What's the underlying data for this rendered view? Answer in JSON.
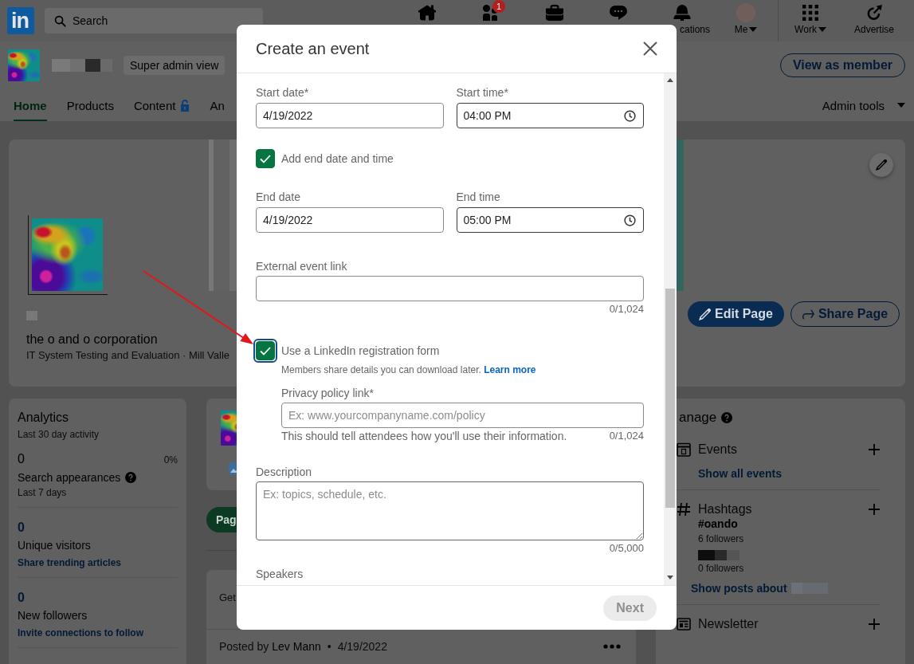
{
  "nav": {
    "logo": "in",
    "search": {
      "placeholder": "Search"
    },
    "items": [
      {
        "kind": "home",
        "dropdown": false
      },
      {
        "kind": "network",
        "badge": "1",
        "dropdown": false
      },
      {
        "kind": "jobs",
        "dropdown": false
      },
      {
        "kind": "messaging",
        "dropdown": false
      },
      {
        "kind": "notifications",
        "label": "cations",
        "dropdown": false
      },
      {
        "kind": "me",
        "label": "Me",
        "dropdown": true
      },
      {
        "kind": "work",
        "label": "Work",
        "dropdown": true
      },
      {
        "kind": "advertise",
        "label": "Advertise",
        "dropdown": false
      }
    ]
  },
  "page_header": {
    "badge": "Super admin view",
    "view_button": "View as member",
    "tabs": [
      {
        "label": "Home",
        "selected": true,
        "locked": false
      },
      {
        "label": "Products",
        "selected": false,
        "locked": false
      },
      {
        "label": "Content",
        "selected": false,
        "locked": true
      },
      {
        "label": "An",
        "selected": false,
        "locked": false
      }
    ],
    "admin_menu": "Admin tools"
  },
  "profile": {
    "tagline": "the o and o corporation",
    "details": "IT System Testing and Evaluation · Mill Valle",
    "edit_button": "Edit Page",
    "share_button": "Share Page"
  },
  "analytics": {
    "title": "Analytics",
    "subtitle": "Last 30 day activity",
    "stats": [
      {
        "kind": "plain",
        "value": "0",
        "change": "0%",
        "label": "Search appearances",
        "help": true,
        "note": "Last 7 days"
      },
      {
        "kind": "action",
        "value": "0",
        "label": "Unique visitors",
        "help": false,
        "link": "Share trending articles"
      },
      {
        "kind": "action",
        "value": "0",
        "label": "New followers",
        "help": false,
        "link": "Invite connections to follow"
      }
    ]
  },
  "feed": {
    "post_button": "Pag",
    "prompt": "Get",
    "post": {
      "prefix": "Posted by",
      "author": "Lev Mann",
      "separator": "•",
      "date": "4/19/2022"
    }
  },
  "manage": {
    "title": "anage",
    "sections": [
      {
        "kind": "events",
        "title": "Events",
        "link": "Show all events"
      },
      {
        "kind": "hashtags",
        "title": "Hashtags",
        "tags": [
          {
            "name": "#oando",
            "followers": "6 followers"
          },
          {
            "followers": "0 followers"
          }
        ],
        "link": "Show posts about"
      },
      {
        "kind": "newsletter",
        "title": "Newsletter"
      }
    ]
  },
  "modal": {
    "title": "Create an event",
    "start_fields": [
      {
        "kind": "date",
        "label": "Start date*",
        "value": "4/19/2022"
      },
      {
        "kind": "time",
        "label": "Start time*",
        "value": "04:00 PM"
      }
    ],
    "end_toggle": {
      "label": "Add end date and time",
      "checked": true,
      "focused": false
    },
    "end_fields": [
      {
        "kind": "date",
        "label": "End date",
        "value": "4/19/2022"
      },
      {
        "kind": "time",
        "label": "End time",
        "value": "05:00 PM"
      }
    ],
    "external_link": {
      "label": "External event link",
      "counter": "0/1,024"
    },
    "registration": {
      "label": "Use a LinkedIn registration form",
      "checked": true,
      "focused": true,
      "note": "Members share details you can download later.",
      "link": "Learn more",
      "privacy": {
        "label": "Privacy policy link*",
        "placeholder": "Ex: www.yourcompanyname.com/policy",
        "hint": "This should tell attendees how you'll use their information.",
        "counter": "0/1,024"
      }
    },
    "description": {
      "label": "Description",
      "placeholder": "Ex: topics, schedule, etc.",
      "counter": "0/5,000"
    },
    "speakers": {
      "label": "Speakers"
    },
    "next_button": {
      "label": "Next",
      "disabled": true
    }
  }
}
